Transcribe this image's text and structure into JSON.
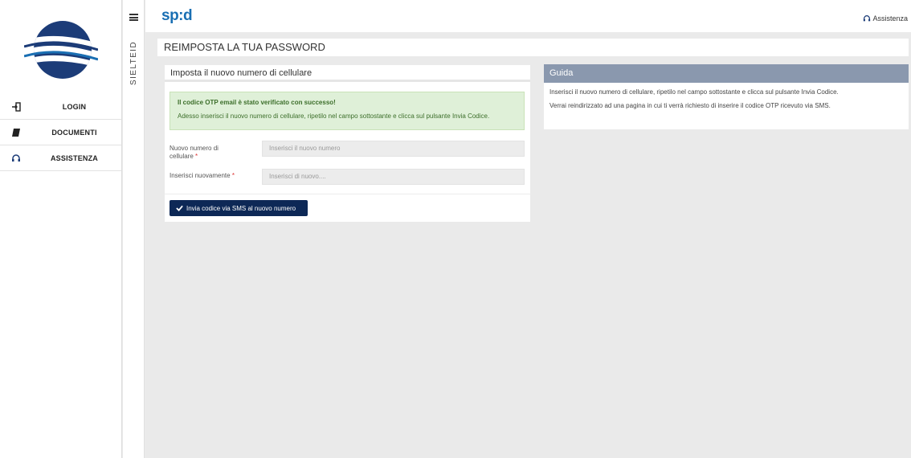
{
  "sidebar": {
    "items": [
      {
        "label": "LOGIN",
        "icon": "login-icon"
      },
      {
        "label": "DOCUMENTI",
        "icon": "book-icon"
      },
      {
        "label": "ASSISTENZA",
        "icon": "headset-icon"
      }
    ]
  },
  "strip": {
    "vertical_label": "SIELTEID"
  },
  "header": {
    "brand": "sp:d",
    "help_label": "Assistenza"
  },
  "page": {
    "title": "REIMPOSTA LA TUA PASSWORD"
  },
  "form_card": {
    "title": "Imposta il nuovo numero di cellulare",
    "alert_title": "Il codice OTP email è stato verificato con successo!",
    "alert_text": "Adesso inserisci il nuovo numero di cellulare, ripetilo nel campo sottostante e clicca sul pulsante Invia Codice.",
    "field1_label_line1": "Nuovo numero di",
    "field1_label_line2": "cellulare",
    "field1_placeholder": "Inserisci il nuovo numero",
    "field2_label": "Inserisci nuovamente",
    "field2_placeholder": "Inserisci di nuovo....",
    "required_mark": "*",
    "submit_label": "Invia codice via SMS al nuovo numero"
  },
  "guide": {
    "title": "Guida",
    "line1": "Inserisci il nuovo numero di cellulare, ripetilo nel campo sottostante e clicca sul pulsante Invia Codice.",
    "line2": "Verrai reindirizzato ad una pagina in cui ti verrà richiesto di inserire il codice OTP ricevuto via SMS."
  },
  "colors": {
    "brand_blue": "#1a6fb3",
    "button_navy": "#0d2856",
    "success_bg": "#dff0d8",
    "guide_header": "#8a98ae"
  }
}
